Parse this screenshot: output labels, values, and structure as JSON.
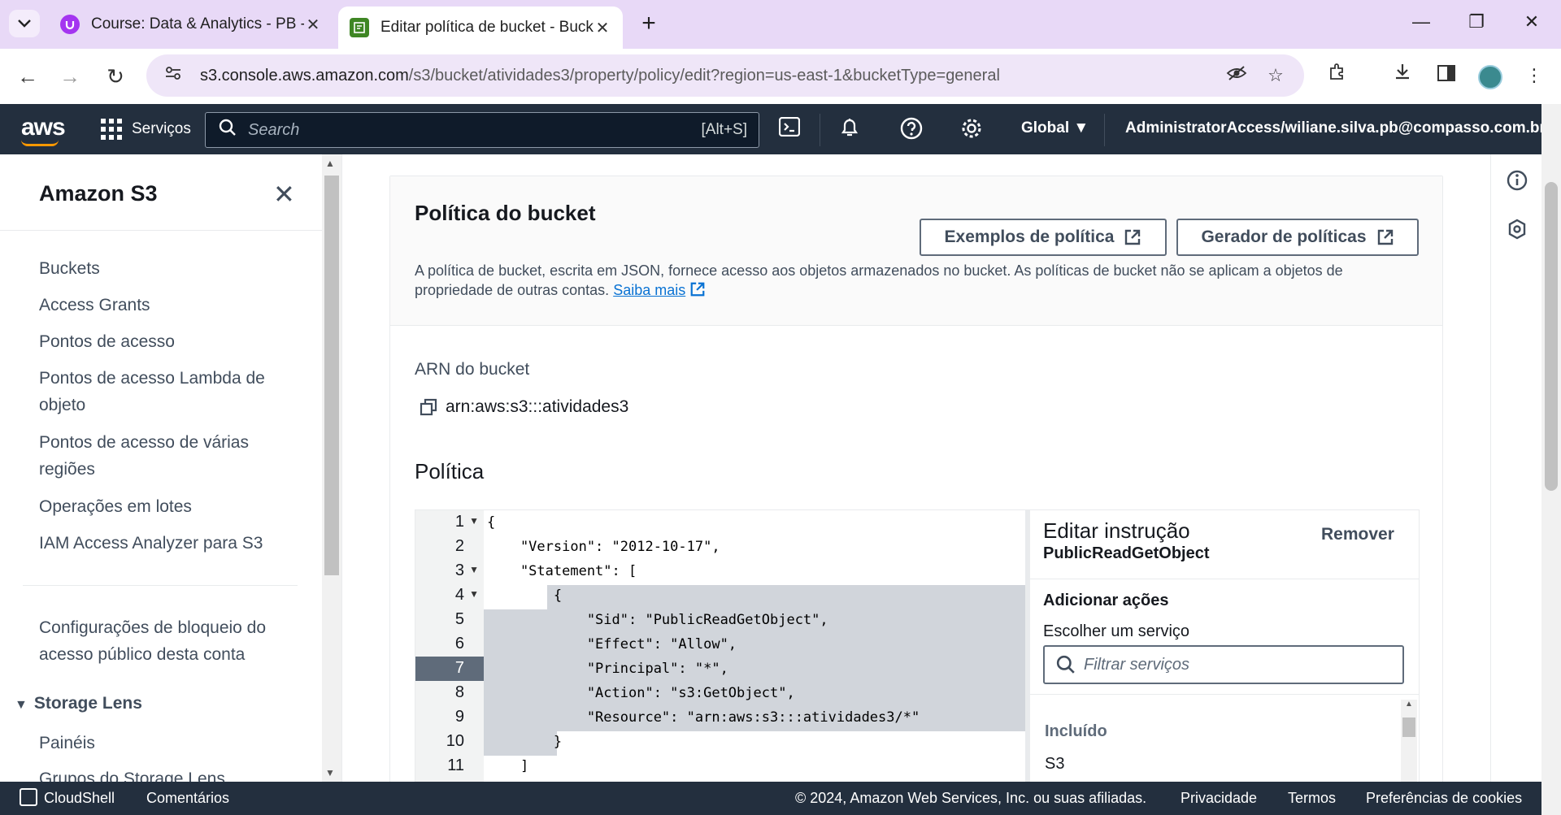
{
  "browser": {
    "tabs": [
      {
        "title": "Course: Data & Analytics - PB -",
        "active": false,
        "favicon": "udemy-icon",
        "color": "#a435f0"
      },
      {
        "title": "Editar política de bucket - Bucke",
        "active": true,
        "favicon": "s3-bucket-icon",
        "color": "#3f8624"
      }
    ],
    "url_host": "s3.console.aws.amazon.com",
    "url_path": "/s3/bucket/atividades3/property/policy/edit?region=us-east-1&bucketType=general"
  },
  "aws_header": {
    "logo": "aws",
    "services_label": "Serviços",
    "search_placeholder": "Search",
    "search_shortcut": "[Alt+S]",
    "region": "Global ▼",
    "account": "AdministratorAccess/wiliane.silva.pb@compasso.com.br ▼"
  },
  "sidenav": {
    "title": "Amazon S3",
    "items": [
      "Buckets",
      "Access Grants",
      "Pontos de acesso",
      "Pontos de acesso Lambda de objeto",
      "Pontos de acesso de várias regiões",
      "Operações em lotes",
      "IAM Access Analyzer para S3"
    ],
    "block_public_access": "Configurações de bloqueio do acesso público desta conta",
    "storage_lens_header": "Storage Lens",
    "storage_lens_items": [
      "Painéis",
      "Grupos do Storage Lens"
    ]
  },
  "panel": {
    "title": "Política do bucket",
    "examples_button": "Exemplos de política",
    "generator_button": "Gerador de políticas",
    "description": "A política de bucket, escrita em JSON, fornece acesso aos objetos armazenados no bucket. As políticas de bucket não se aplicam a objetos de propriedade de outras contas.",
    "learn_more": "Saiba mais",
    "arn_label": "ARN do bucket",
    "arn_value": "arn:aws:s3:::atividades3",
    "policy_label": "Política"
  },
  "editor": {
    "line_numbers": [
      "1",
      "2",
      "3",
      "4",
      "5",
      "6",
      "7",
      "8",
      "9",
      "10",
      "11"
    ],
    "current_line": 7,
    "lines": [
      "{",
      "    \"Version\": \"2012-10-17\",",
      "    \"Statement\": [",
      "        {",
      "            \"Sid\": \"PublicReadGetObject\",",
      "            \"Effect\": \"Allow\",",
      "            \"Principal\": \"*\",",
      "            \"Action\": \"s3:GetObject\",",
      "            \"Resource\": \"arn:aws:s3:::atividades3/*\"",
      "        }",
      "    ]"
    ]
  },
  "statement_panel": {
    "title": "Editar instrução",
    "sid": "PublicReadGetObject",
    "remove": "Remover",
    "add_actions": "Adicionar ações",
    "choose_service": "Escolher um serviço",
    "filter_placeholder": "Filtrar serviços",
    "included_header": "Incluído",
    "included_service": "S3"
  },
  "footer": {
    "cloudshell": "CloudShell",
    "feedback": "Comentários",
    "copyright": "© 2024, Amazon Web Services, Inc. ou suas afiliadas.",
    "privacy": "Privacidade",
    "terms": "Termos",
    "cookies": "Preferências de cookies"
  },
  "colors": {
    "aws_dark": "#232f3e",
    "aws_orange": "#ff9900",
    "link_blue": "#0972d3",
    "tab_strip": "#e8d9f7"
  }
}
